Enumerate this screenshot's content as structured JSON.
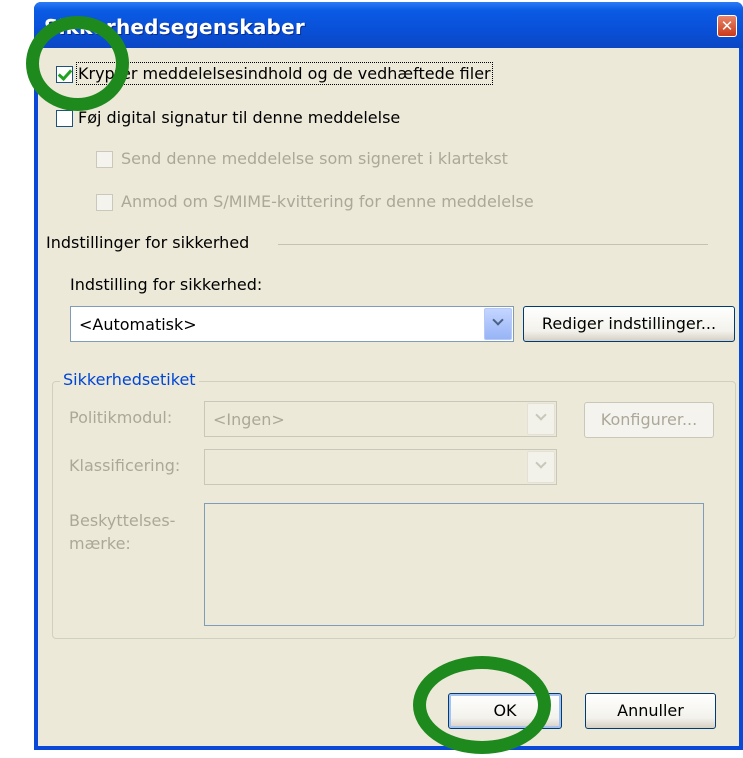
{
  "window": {
    "title": "Sikkerhedsegenskaber",
    "close_glyph": "✕"
  },
  "options": {
    "encrypt": {
      "label": "Krypter meddelelsesindhold og de vedhæftede filer",
      "checked": true
    },
    "sign": {
      "label": "Føj digital signatur til denne meddelelse",
      "checked": false
    },
    "cleartext": {
      "label": "Send denne meddelelse som signeret i klartekst",
      "checked": false,
      "enabled": false
    },
    "receipt": {
      "label": "Anmod om S/MIME-kvittering for denne meddelelse",
      "checked": false,
      "enabled": false
    }
  },
  "security_settings": {
    "group_title": "Indstillinger for sikkerhed",
    "setting_label": "Indstilling for sikkerhed:",
    "setting_value": "<Automatisk>",
    "edit_button": "Rediger indstillinger..."
  },
  "security_label": {
    "legend": "Sikkerhedsetiket",
    "policy_label": "Politikmodul:",
    "policy_value": "<Ingen>",
    "configure_button": "Konfigurer...",
    "classification_label": "Klassificering:",
    "classification_value": "",
    "privacy_label_line1": "Beskyttelses-",
    "privacy_label_line2": "mærke:"
  },
  "footer": {
    "ok": "OK",
    "cancel": "Annuller"
  },
  "annotations": {
    "color": "#1E8A1E"
  }
}
